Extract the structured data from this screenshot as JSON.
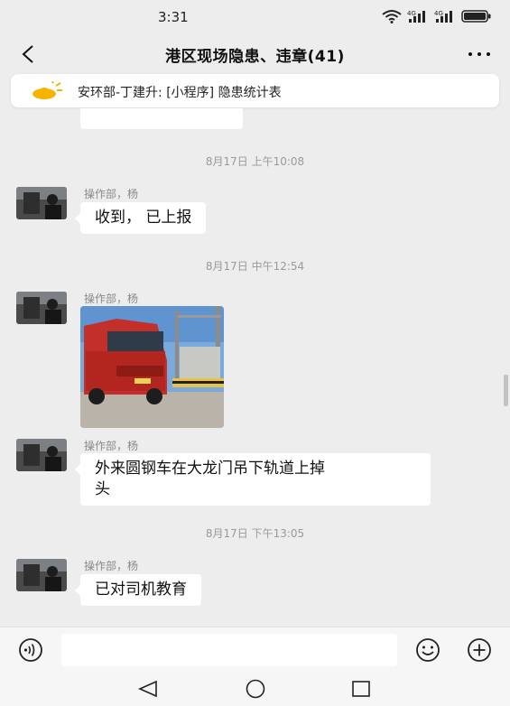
{
  "status_bar": {
    "time": "3:31",
    "signal_1_label": "4G",
    "signal_2_label": "4G",
    "icons": [
      "wifi-icon",
      "signal-icon",
      "signal-icon",
      "battery-icon"
    ]
  },
  "header": {
    "title": "港区现场隐患、违章(41)",
    "back_icon": "chevron-left-icon",
    "more_icon": "more-icon"
  },
  "pinned_notice": {
    "icon": "weather-sun-icon",
    "text": "安环部-丁建升: [小程序] 隐患统计表"
  },
  "messages": [
    {
      "timestamp": "8月17日 上午10:08",
      "sender": "操作部，杨",
      "type": "text",
      "text": "收到， 已上报"
    },
    {
      "timestamp": "8月17日 中午12:54",
      "sender": "操作部，杨",
      "type": "image",
      "image_description_icon": "photo-icon"
    },
    {
      "sender": "操作部，杨",
      "type": "text",
      "text_line_1": "外来圆钢车在大龙门吊下轨道上掉",
      "text_line_2": "头"
    },
    {
      "timestamp": "8月17日 下午13:05",
      "sender": "操作部，杨",
      "type": "text",
      "text": "已对司机教育"
    }
  ],
  "input_bar": {
    "value": "",
    "voice_icon": "voice-icon",
    "emoji_icon": "emoji-icon",
    "plus_icon": "plus-icon"
  },
  "system_nav": {
    "icons": [
      "back-triangle-icon",
      "home-circle-icon",
      "recents-square-icon"
    ]
  },
  "colors": {
    "background": "#ededed",
    "bubble": "#ffffff",
    "accent_sun": "#f5b400"
  }
}
